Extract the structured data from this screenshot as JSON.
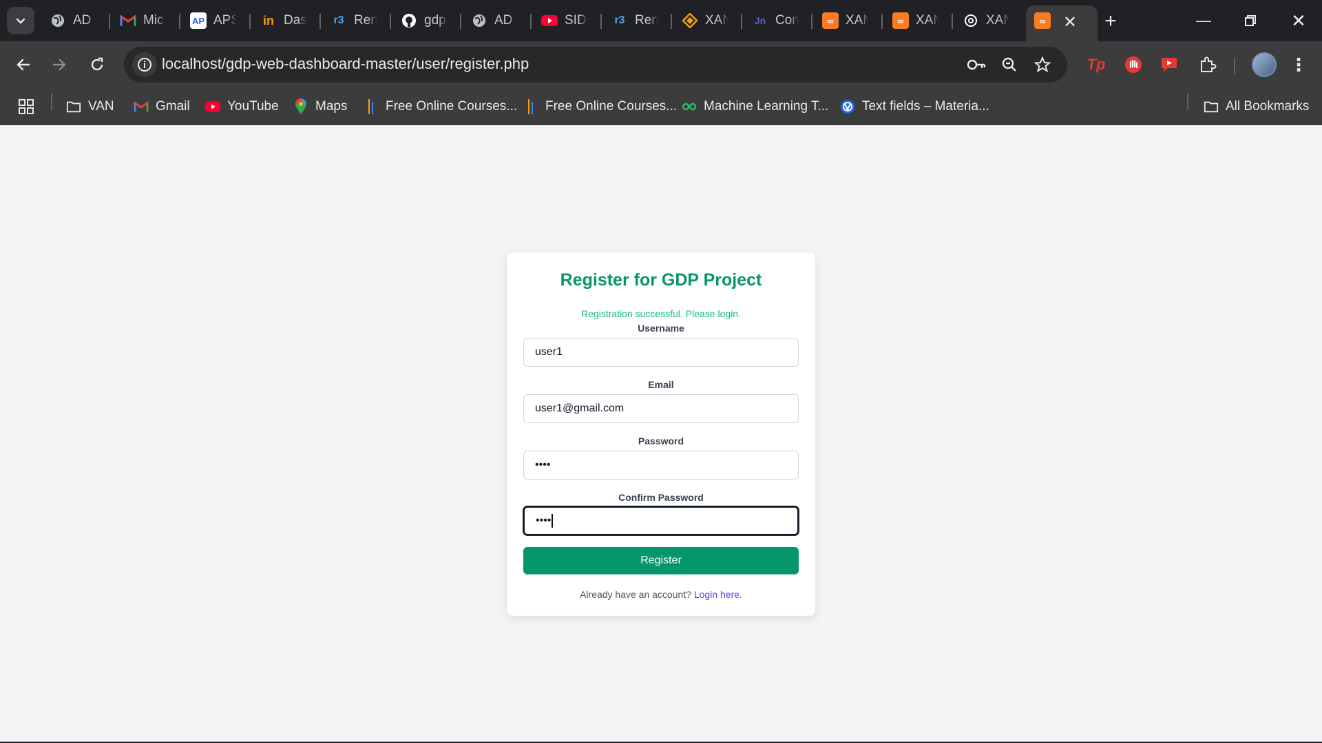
{
  "browser": {
    "tabs": [
      {
        "title": "AD (",
        "icon": "globe-icon",
        "color": "#bdc1c6"
      },
      {
        "title": "Mic",
        "icon": "gmail-icon",
        "color": "#ea4335"
      },
      {
        "title": "APS",
        "icon": "aps-icon",
        "color": "#ffffff"
      },
      {
        "title": "Dasl",
        "icon": "dashboard-icon",
        "color": "#f59e0b"
      },
      {
        "title": "Ren",
        "icon": "render-icon",
        "color": "#4ea1f3"
      },
      {
        "title": "gdp",
        "icon": "github-icon",
        "color": "#ffffff"
      },
      {
        "title": "AD (",
        "icon": "globe-icon",
        "color": "#bdc1c6"
      },
      {
        "title": "SIDI",
        "icon": "youtube-icon",
        "color": "#ff0033"
      },
      {
        "title": "Ren",
        "icon": "render-icon",
        "color": "#4ea1f3"
      },
      {
        "title": "XAN",
        "icon": "xampp-diamond-icon",
        "color": "#f59e0b"
      },
      {
        "title": "Con",
        "icon": "jira-icon",
        "color": "#3b3bb3"
      },
      {
        "title": "XAN",
        "icon": "xampp-icon",
        "color": "#fb7a24"
      },
      {
        "title": "XAN",
        "icon": "xampp-icon",
        "color": "#fb7a24"
      },
      {
        "title": "XAN",
        "icon": "openai-icon",
        "color": "#ffffff"
      }
    ],
    "active_tab": {
      "icon": "xampp-icon",
      "color": "#fb7a24"
    },
    "url": "localhost/gdp-web-dashboard-master/user/register.php",
    "bookmarks": [
      {
        "label": "VAN",
        "icon": "folder-icon"
      },
      {
        "label": "Gmail",
        "icon": "gmail-icon"
      },
      {
        "label": "YouTube",
        "icon": "youtube-icon"
      },
      {
        "label": "Maps",
        "icon": "maps-icon"
      },
      {
        "label": "Free Online Courses...",
        "icon": "course-icon"
      },
      {
        "label": "Free Online Courses...",
        "icon": "course-icon"
      },
      {
        "label": "Machine Learning T...",
        "icon": "ml-icon"
      },
      {
        "label": "Text fields – Materia...",
        "icon": "material-icon"
      }
    ],
    "all_bookmarks": "All Bookmarks"
  },
  "form": {
    "title": "Register for GDP Project",
    "success_message": "Registration successful. Please login.",
    "username_label": "Username",
    "username_value": "user1",
    "email_label": "Email",
    "email_value": "user1@gmail.com",
    "password_label": "Password",
    "password_value": "••••",
    "confirm_label": "Confirm Password",
    "confirm_value": "••••",
    "register_label": "Register",
    "footer_text": "Already have an account?",
    "login_link": "Login here."
  },
  "colors": {
    "accent": "#059669",
    "success": "#10b981",
    "link": "#4f46e5"
  }
}
